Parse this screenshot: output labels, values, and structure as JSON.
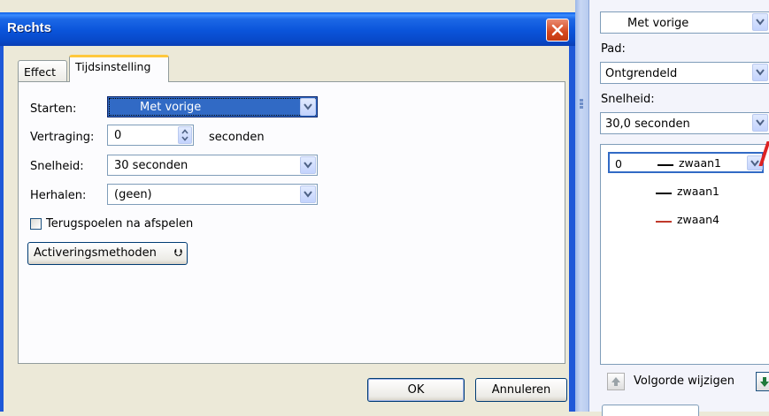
{
  "dialog": {
    "title": "Rechts",
    "tabs": [
      {
        "label": "Effect",
        "active": false
      },
      {
        "label": "Tijdsinstelling",
        "active": true
      }
    ],
    "starten": {
      "label": "Starten:",
      "value": "Met vorige"
    },
    "vertraging": {
      "label": "Vertraging:",
      "value": "0",
      "unit": "seconden"
    },
    "snelheid": {
      "label": "Snelheid:",
      "value": "30 seconden"
    },
    "herhalen": {
      "label": "Herhalen:",
      "value": "(geen)"
    },
    "rewind": {
      "label": "Terugspoelen na afspelen",
      "checked": false
    },
    "triggers_label": "Activeringsmethoden",
    "ok_label": "OK",
    "cancel_label": "Annuleren"
  },
  "pane": {
    "start_value": "Met vorige",
    "pad": {
      "label": "Pad:",
      "value": "Ontgrendeld"
    },
    "snelheid": {
      "label": "Snelheid:",
      "value": "30,0 seconden"
    },
    "list": [
      {
        "num": "0",
        "name": "zwaan1",
        "selected": true,
        "line_color": "#000000"
      },
      {
        "num": "",
        "name": "zwaan1",
        "selected": false,
        "line_color": "#000000"
      },
      {
        "num": "",
        "name": "zwaan4",
        "selected": false,
        "line_color": "#c0392b"
      }
    ],
    "reorder_label": "Volgorde wijzigen"
  },
  "colors": {
    "title_bar": "#0a54da",
    "selection": "#316ac5",
    "close_button": "#d5471e"
  }
}
